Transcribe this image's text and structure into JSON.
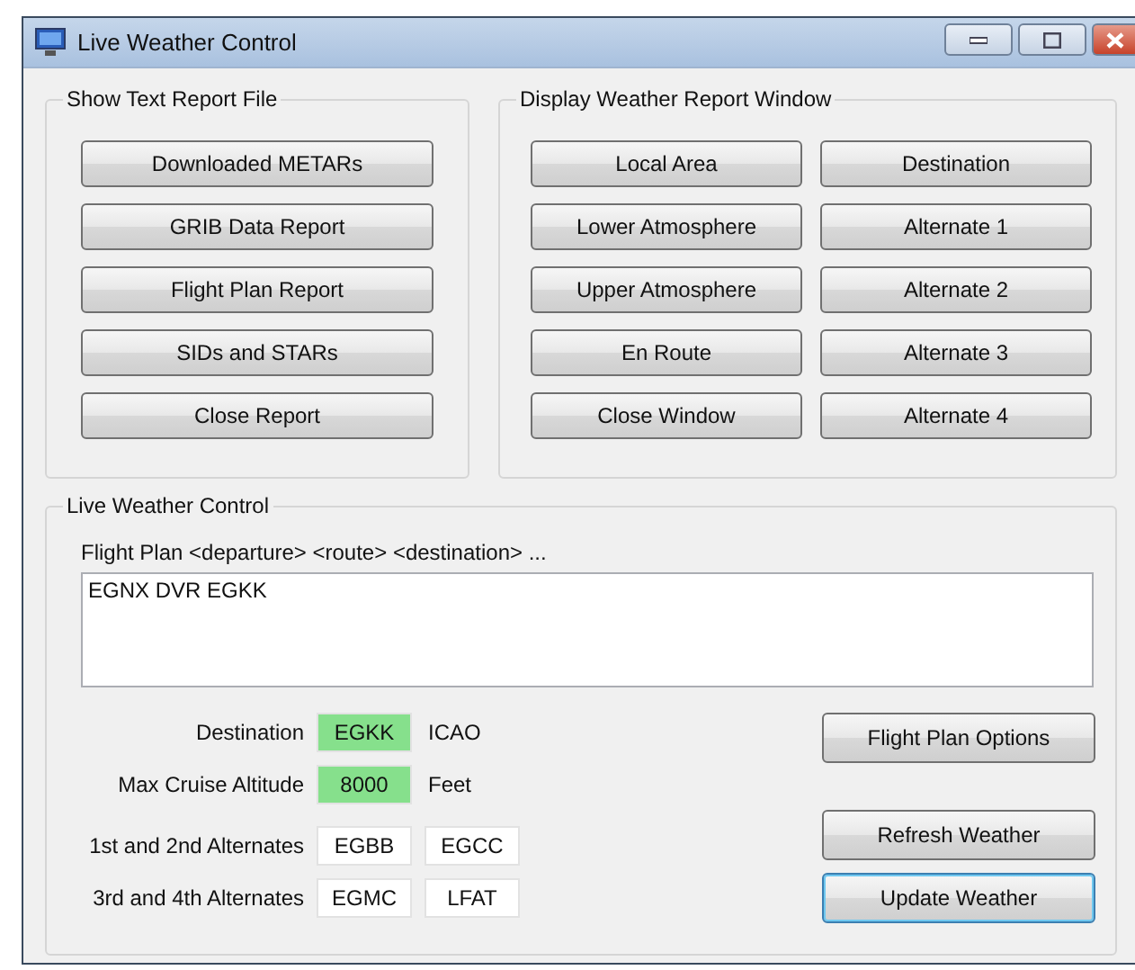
{
  "window": {
    "title": "Live Weather Control"
  },
  "text_report": {
    "title": "Show Text Report File",
    "buttons": [
      {
        "label": "Downloaded METARs",
        "focused": false
      },
      {
        "label": "GRIB Data Report",
        "focused": false
      },
      {
        "label": "Flight Plan Report",
        "focused": false
      },
      {
        "label": "SIDs and STARs",
        "focused": false
      },
      {
        "label": "Close Report",
        "focused": false
      }
    ]
  },
  "report_window": {
    "title": "Display Weather Report Window",
    "buttons": [
      {
        "label": "Local Area",
        "focused": false
      },
      {
        "label": "Destination",
        "focused": false
      },
      {
        "label": "Lower Atmosphere",
        "focused": false
      },
      {
        "label": "Alternate 1",
        "focused": false
      },
      {
        "label": "Upper Atmosphere",
        "focused": false
      },
      {
        "label": "Alternate 2",
        "focused": false
      },
      {
        "label": "En Route",
        "focused": false
      },
      {
        "label": "Alternate 3",
        "focused": false
      },
      {
        "label": "Close Window",
        "focused": false
      },
      {
        "label": "Alternate 4",
        "focused": false
      }
    ]
  },
  "live_control": {
    "title": "Live Weather Control",
    "flight_plan_label": "Flight Plan <departure> <route> <destination> ...",
    "flight_plan": "EGNX DVR EGKK",
    "rows": [
      {
        "label": "Destination",
        "fields": [
          {
            "value": "EGKK",
            "valid": true
          }
        ],
        "unit": "ICAO"
      },
      {
        "label": "Max Cruise Altitude",
        "fields": [
          {
            "value": "8000",
            "valid": true
          }
        ],
        "unit": "Feet"
      },
      {
        "label": "1st and 2nd Alternates",
        "fields": [
          {
            "value": "EGBB",
            "valid": false
          },
          {
            "value": "EGCC",
            "valid": false
          }
        ]
      },
      {
        "label": "3rd and 4th Alternates",
        "fields": [
          {
            "value": "EGMC",
            "valid": false
          },
          {
            "value": "LFAT",
            "valid": false
          }
        ]
      }
    ],
    "buttons": [
      {
        "label": "Flight Plan Options",
        "focused": false
      },
      {
        "label": "Refresh Weather",
        "focused": false
      },
      {
        "label": "Update Weather",
        "focused": true
      }
    ]
  }
}
